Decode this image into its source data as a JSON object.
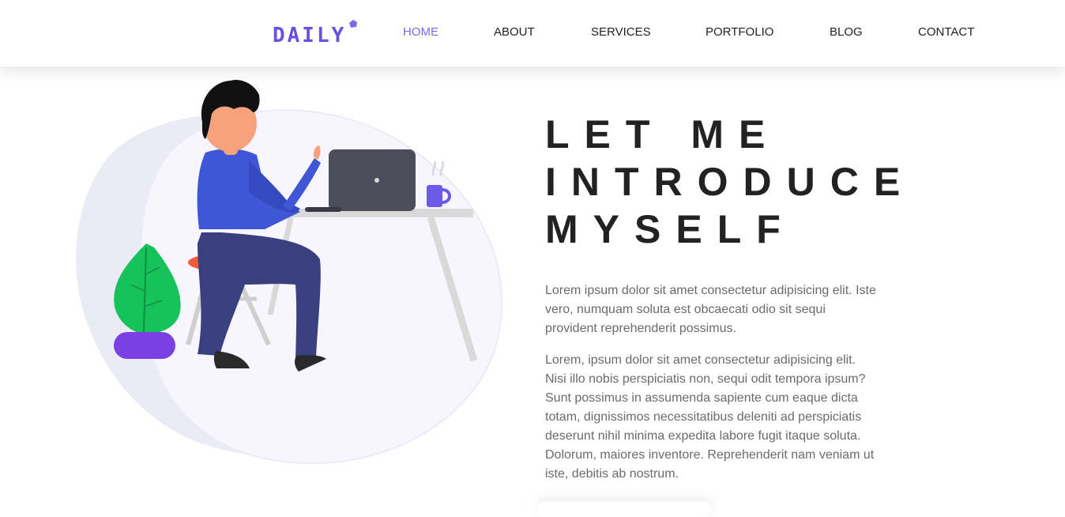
{
  "brand": {
    "logo_text": "DAILY",
    "accent_color": "#6a4fe0"
  },
  "nav": {
    "items": [
      {
        "label": "HOME",
        "active": true
      },
      {
        "label": "ABOUT",
        "active": false
      },
      {
        "label": "SERVICES",
        "active": false
      },
      {
        "label": "PORTFOLIO",
        "active": false
      },
      {
        "label": "BLOG",
        "active": false
      },
      {
        "label": "CONTACT",
        "active": false
      }
    ],
    "active_color": "#7b68ee"
  },
  "hero": {
    "title_line1": "LET ME",
    "title_line2": "INTRODUCE",
    "title_line3": "MYSELF",
    "paragraph1": "Lorem ipsum dolor sit amet consectetur adipisicing elit. Iste vero, numquam soluta est obcaecati odio sit sequi provident reprehenderit possimus.",
    "paragraph2": "Lorem, ipsum dolor sit amet consectetur adipisicing elit. Nisi illo nobis perspiciatis non, sequi odit tempora ipsum? Sunt possimus in assumenda sapiente cum eaque dicta totam, dignissimos necessitatibus deleniti ad perspiciatis deserunt nihil minima expedita labore fugit itaque soluta. Dolorum, maiores inventore. Reprehenderit nam veniam ut iste, debitis ab nostrum.",
    "illustration": "person-working-at-laptop"
  }
}
